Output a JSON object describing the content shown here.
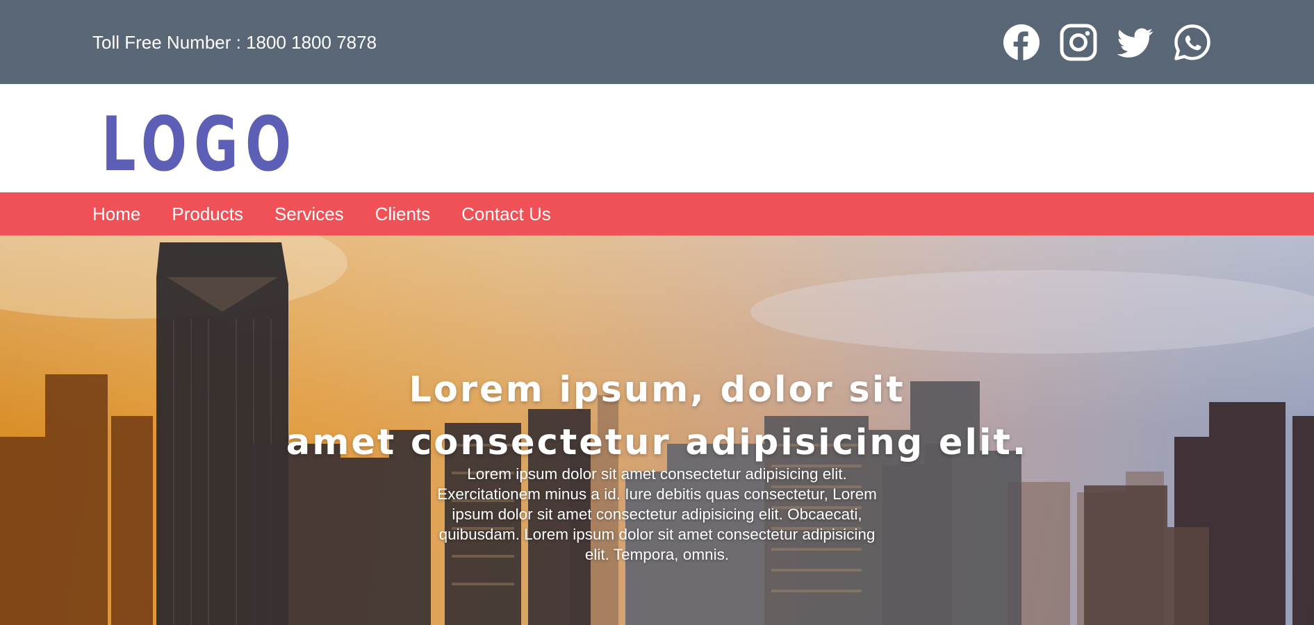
{
  "topbar": {
    "toll_free": "Toll Free Number : 1800 1800 7878",
    "social_icons": [
      "facebook-icon",
      "instagram-icon",
      "twitter-icon",
      "whatsapp-icon"
    ]
  },
  "header": {
    "logo_text": "LOGO"
  },
  "nav": {
    "items": [
      {
        "label": "Home"
      },
      {
        "label": "Products"
      },
      {
        "label": "Services"
      },
      {
        "label": "Clients"
      },
      {
        "label": "Contact Us"
      }
    ]
  },
  "hero": {
    "title_line1": "Lorem ipsum, dolor sit",
    "title_line2": "amet consectetur adipisicing elit.",
    "text": "Lorem ipsum dolor sit amet consectetur adipisicing elit. Exercitationem minus a id. Iure debitis quas consectetur, Lorem ipsum dolor sit amet consectetur adipisicing elit. Obcaecati, quibusdam. Lorem ipsum dolor sit amet consectetur adipisicing elit. Tempora, omnis."
  },
  "colors": {
    "topbar": "#596675",
    "nav": "#ef5157",
    "logo": "#5c5fb5"
  }
}
